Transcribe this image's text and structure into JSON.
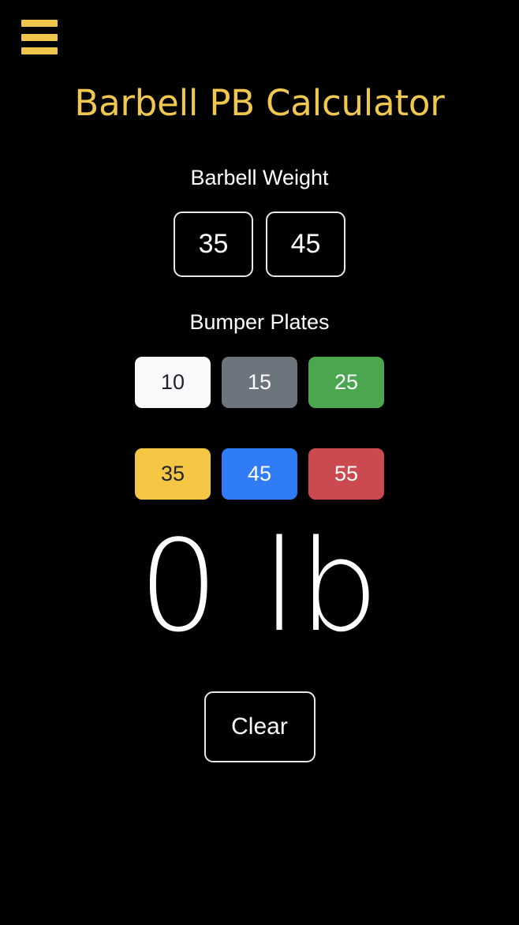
{
  "app": {
    "title": "Barbell PB Calculator",
    "background_color": "#000000",
    "accent_color": "#f0c850"
  },
  "header": {
    "menu_icon": "hamburger-menu-icon",
    "menu_color": "#efc64b",
    "title": "Barbell PB Calculator"
  },
  "barbell_section": {
    "label": "Barbell Weight",
    "options": [
      {
        "value": "35",
        "selected": false
      },
      {
        "value": "45",
        "selected": false
      }
    ]
  },
  "plates_section": {
    "label": "Bumper Plates",
    "rows": [
      [
        {
          "value": "10",
          "bg": "#f8f9fa",
          "fg": "#212529"
        },
        {
          "value": "15",
          "bg": "#6c757d",
          "fg": "#ffffff"
        },
        {
          "value": "25",
          "bg": "#4ca64f",
          "fg": "#ffffff"
        }
      ],
      [
        {
          "value": "35",
          "bg": "#f4c643",
          "fg": "#212529"
        },
        {
          "value": "45",
          "bg": "#307bf6",
          "fg": "#ffffff"
        },
        {
          "value": "55",
          "bg": "#ca4a50",
          "fg": "#ffffff"
        }
      ]
    ]
  },
  "total": {
    "value": "0",
    "unit": "lb",
    "display": "0 lb"
  },
  "actions": {
    "clear_label": "Clear"
  }
}
